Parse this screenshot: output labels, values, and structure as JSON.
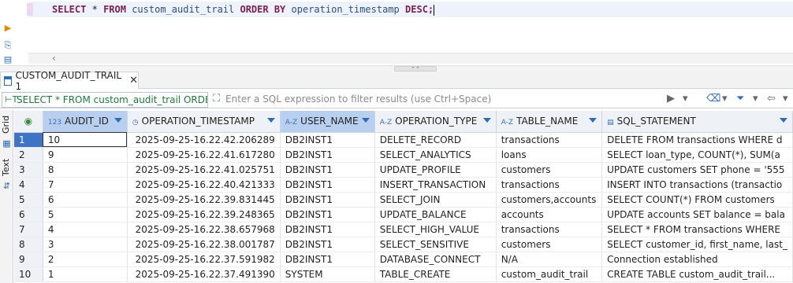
{
  "editor": {
    "sql_parts": {
      "select": "SELECT",
      "star": "*",
      "from": "FROM",
      "table": "custom_audit_trail",
      "orderby": "ORDER BY",
      "column": "operation_timestamp",
      "desc": "DESC;"
    }
  },
  "result_tab": {
    "label": "CUSTOM_AUDIT_TRAIL 1"
  },
  "filter_bar": {
    "query_text": "SELECT * FROM custom_audit_trail ORDER BY",
    "placeholder": "Enter a SQL expression to filter results (use Ctrl+Space)"
  },
  "side_strip": {
    "grid_label": "Grid",
    "text_label": "Text"
  },
  "grid": {
    "columns": [
      {
        "type_badge": "123",
        "name": "AUDIT_ID"
      },
      {
        "type_badge": "◷",
        "name": "OPERATION_TIMESTAMP"
      },
      {
        "type_badge": "A-Z",
        "name": "USER_NAME"
      },
      {
        "type_badge": "A-Z",
        "name": "OPERATION_TYPE"
      },
      {
        "type_badge": "A-Z",
        "name": "TABLE_NAME"
      },
      {
        "type_badge": "▤",
        "name": "SQL_STATEMENT"
      }
    ],
    "rows": [
      [
        "1",
        "10",
        "2025-09-25-16.22.42.206289",
        "DB2INST1",
        "DELETE_RECORD",
        "transactions",
        "DELETE FROM transactions WHERE d"
      ],
      [
        "2",
        "9",
        "2025-09-25-16.22.41.617280",
        "DB2INST1",
        "SELECT_ANALYTICS",
        "loans",
        "SELECT loan_type, COUNT(*), SUM(a"
      ],
      [
        "3",
        "8",
        "2025-09-25-16.22.41.025751",
        "DB2INST1",
        "UPDATE_PROFILE",
        "customers",
        "UPDATE customers SET phone = '555"
      ],
      [
        "4",
        "7",
        "2025-09-25-16.22.40.421333",
        "DB2INST1",
        "INSERT_TRANSACTION",
        "transactions",
        "INSERT INTO transactions (transactio"
      ],
      [
        "5",
        "6",
        "2025-09-25-16.22.39.831445",
        "DB2INST1",
        "SELECT_JOIN",
        "customers,accounts",
        "SELECT COUNT(*) FROM customers"
      ],
      [
        "6",
        "5",
        "2025-09-25-16.22.39.248365",
        "DB2INST1",
        "UPDATE_BALANCE",
        "accounts",
        "UPDATE accounts SET balance = bala"
      ],
      [
        "7",
        "4",
        "2025-09-25-16.22.38.657968",
        "DB2INST1",
        "SELECT_HIGH_VALUE",
        "transactions",
        "SELECT * FROM transactions WHERE"
      ],
      [
        "8",
        "3",
        "2025-09-25-16.22.38.001787",
        "DB2INST1",
        "SELECT_SENSITIVE",
        "customers",
        "SELECT customer_id, first_name, last_"
      ],
      [
        "9",
        "2",
        "2025-09-25-16.22.37.591982",
        "DB2INST1",
        "DATABASE_CONNECT",
        "N/A",
        "Connection established"
      ],
      [
        "10",
        "1",
        "2025-09-25-16.22.37.491390",
        "SYSTEM",
        "TABLE_CREATE",
        "custom_audit_trail",
        "CREATE TABLE custom_audit_trail..."
      ]
    ]
  }
}
